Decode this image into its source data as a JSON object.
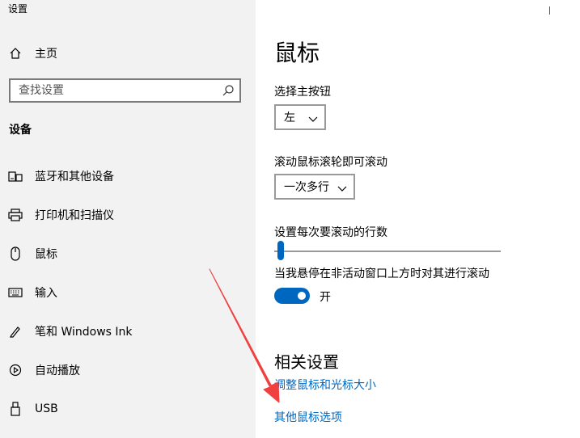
{
  "window": {
    "title": "设置"
  },
  "sidebar": {
    "home_label": "主页",
    "search_placeholder": "查找设置",
    "section_heading": "设备",
    "items": [
      {
        "label": "蓝牙和其他设备",
        "icon": "bluetooth-devices-icon"
      },
      {
        "label": "打印机和扫描仪",
        "icon": "printer-icon"
      },
      {
        "label": "鼠标",
        "icon": "mouse-icon"
      },
      {
        "label": "输入",
        "icon": "keyboard-icon"
      },
      {
        "label": "笔和 Windows Ink",
        "icon": "pen-icon"
      },
      {
        "label": "自动播放",
        "icon": "autoplay-icon"
      },
      {
        "label": "USB",
        "icon": "usb-icon"
      }
    ]
  },
  "main": {
    "title": "鼠标",
    "primary_button": {
      "label": "选择主按钮",
      "value": "左"
    },
    "scroll_mode": {
      "label": "滚动鼠标滚轮即可滚动",
      "value": "一次多行"
    },
    "lines_to_scroll": {
      "label": "设置每次要滚动的行数",
      "value_fraction": 0.03
    },
    "inactive_scroll": {
      "label": "当我悬停在非活动窗口上方时对其进行滚动",
      "state_label": "开",
      "on": true
    },
    "related": {
      "heading": "相关设置",
      "links": [
        "调整鼠标和光标大小",
        "其他鼠标选项"
      ]
    }
  },
  "colors": {
    "accent": "#0067c0",
    "annotation_arrow": "#f04040",
    "sidebar_bg": "#f2f2f2"
  }
}
